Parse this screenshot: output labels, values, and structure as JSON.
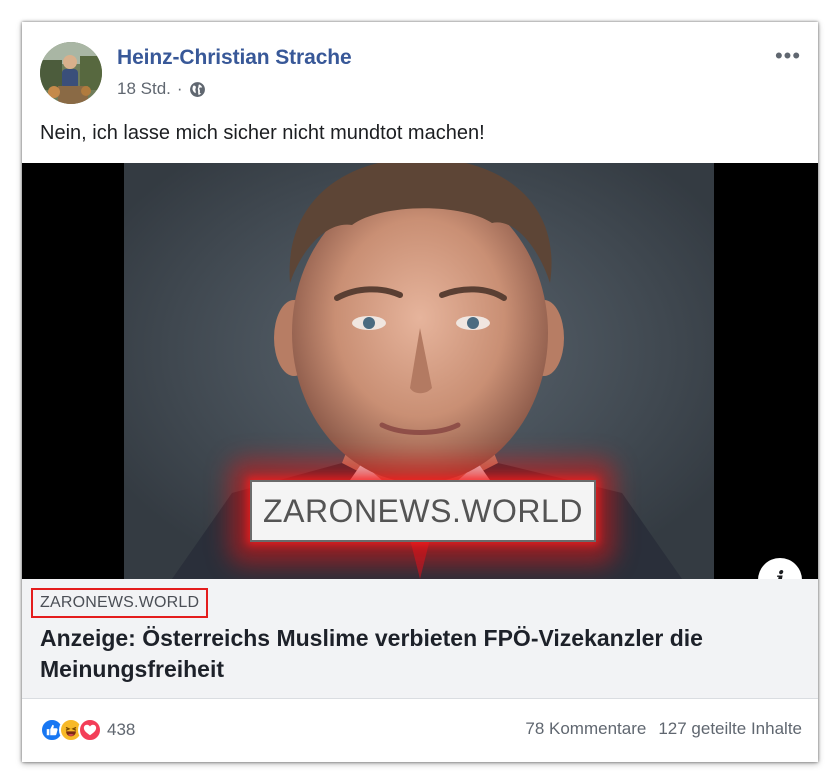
{
  "post": {
    "author": "Heinz-Christian Strache",
    "timestamp": "18 Std.",
    "separator": "·",
    "privacy_icon": "globe-icon",
    "more_icon": "•••",
    "text": "Nein, ich lasse mich sicher nicht mundtot machen!"
  },
  "media": {
    "watermark_text": "ZARONEWS.WORLD",
    "info_icon": "i",
    "highlight_color": "#e41d1d"
  },
  "link_preview": {
    "domain": "ZARONEWS.WORLD",
    "headline": "Anzeige: Österreichs Muslime verbieten FPÖ-Vizekanzler die Meinungsfreiheit"
  },
  "footer": {
    "reaction_icons": [
      "like-icon",
      "haha-icon",
      "love-icon"
    ],
    "reaction_count": "438",
    "comments": "78 Kommentare",
    "shares": "127 geteilte Inhalte"
  },
  "colors": {
    "author_link": "#385898",
    "like_blue": "#1877f2",
    "haha_yellow": "#f7b928",
    "love_red": "#f33e58",
    "secondary_text": "#606770"
  }
}
